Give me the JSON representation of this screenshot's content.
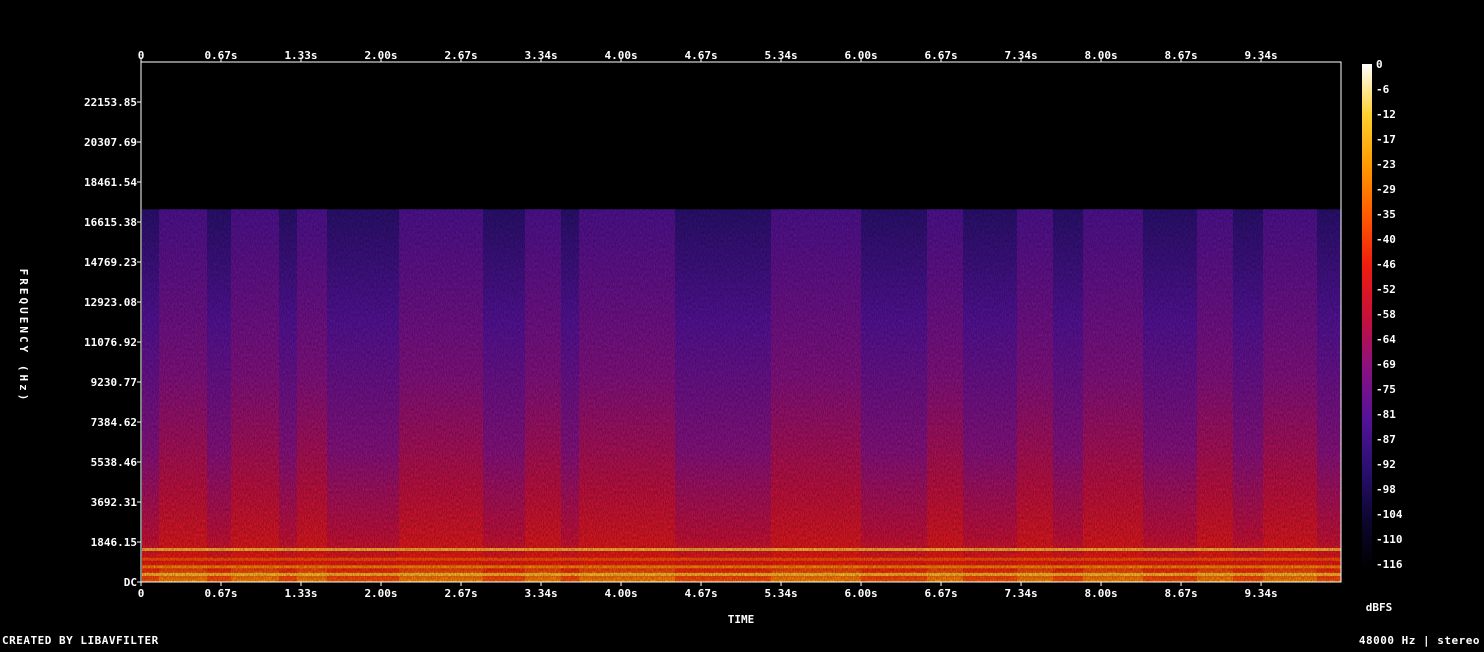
{
  "chart_data": {
    "type": "heatmap",
    "title": "",
    "xlabel": "TIME",
    "ylabel": "FREQUENCY (Hz)",
    "x_ticks_top": [
      "0",
      "0.67s",
      "1.33s",
      "2.00s",
      "2.67s",
      "3.34s",
      "4.00s",
      "4.67s",
      "5.34s",
      "6.00s",
      "6.67s",
      "7.34s",
      "8.00s",
      "8.67s",
      "9.34s"
    ],
    "x_ticks_bottom": [
      "0",
      "0.67s",
      "1.33s",
      "2.00s",
      "2.67s",
      "3.34s",
      "4.00s",
      "4.67s",
      "5.34s",
      "6.00s",
      "6.67s",
      "7.34s",
      "8.00s",
      "8.67s",
      "9.34s"
    ],
    "y_ticks": [
      "DC",
      "1846.15",
      "3692.31",
      "5538.46",
      "7384.62",
      "9230.77",
      "11076.92",
      "12923.08",
      "14769.23",
      "16615.38",
      "18461.54",
      "20307.69",
      "22153.85"
    ],
    "ylim_hz": [
      0,
      24000
    ],
    "xlim_s": [
      0,
      10.0
    ],
    "content_cutoff_hz": 17200,
    "colorbar_label": "dBFS",
    "colorbar_ticks": [
      "0",
      "-6",
      "-12",
      "-17",
      "-23",
      "-29",
      "-35",
      "-40",
      "-46",
      "-52",
      "-58",
      "-64",
      "-69",
      "-75",
      "-81",
      "-87",
      "-92",
      "-98",
      "-104",
      "-110",
      "-116"
    ],
    "colormap_stops": [
      "#000000",
      "#0d0630",
      "#2a1070",
      "#551299",
      "#8a1180",
      "#c7103a",
      "#ee1c10",
      "#ff5a00",
      "#ff9a00",
      "#ffd030",
      "#ffffff"
    ],
    "loud_segments_s": [
      [
        0.15,
        0.55
      ],
      [
        0.75,
        1.15
      ],
      [
        1.3,
        1.55
      ],
      [
        2.15,
        2.85
      ],
      [
        3.2,
        3.5
      ],
      [
        3.65,
        4.45
      ],
      [
        5.25,
        6.0
      ],
      [
        6.55,
        6.85
      ],
      [
        7.3,
        7.6
      ],
      [
        7.85,
        8.35
      ],
      [
        8.8,
        9.1
      ],
      [
        9.35,
        9.8
      ]
    ]
  },
  "footer": {
    "left": "CREATED BY LIBAVFILTER",
    "right": "48000 Hz | stereo"
  }
}
